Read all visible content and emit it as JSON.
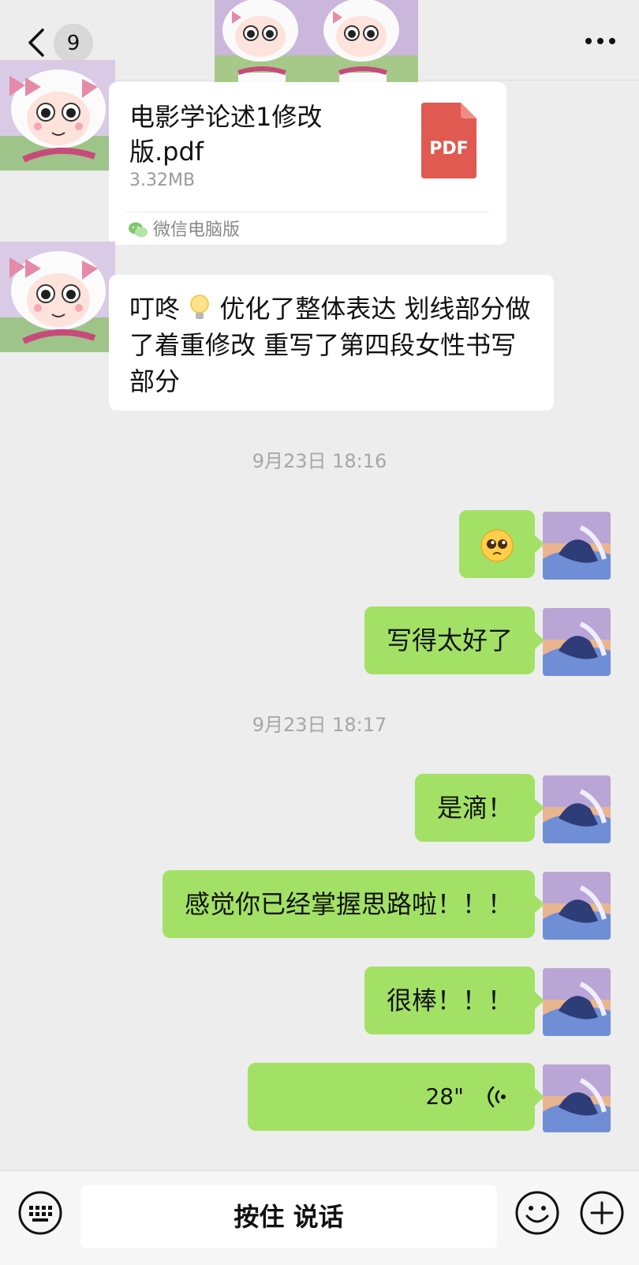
{
  "header": {
    "unread_count": "9"
  },
  "file_message": {
    "file_name": "电影学论述1修改版.pdf",
    "file_size": "3.32MB",
    "file_type_label": "PDF",
    "source_label": "微信电脑版"
  },
  "text_message_in": {
    "part1": "叮咚",
    "part2": "优化了整体表达 划线部分做了着重修改 重写了第四段女性书写部分"
  },
  "timestamps": [
    "9月23日 18:16",
    "9月23日 18:17"
  ],
  "outgoing": {
    "msg1": "写得太好了",
    "msg2": "是滴！",
    "msg3": "感觉你已经掌握思路啦！！！",
    "msg4": "很棒！！！",
    "voice_length": "28\""
  },
  "bottom_bar": {
    "hold_to_talk": "按住 说话"
  },
  "colors": {
    "bubble_out": "#a2e165",
    "bubble_in": "#ffffff",
    "background": "#ededed",
    "pdf_red": "#e05a51"
  }
}
